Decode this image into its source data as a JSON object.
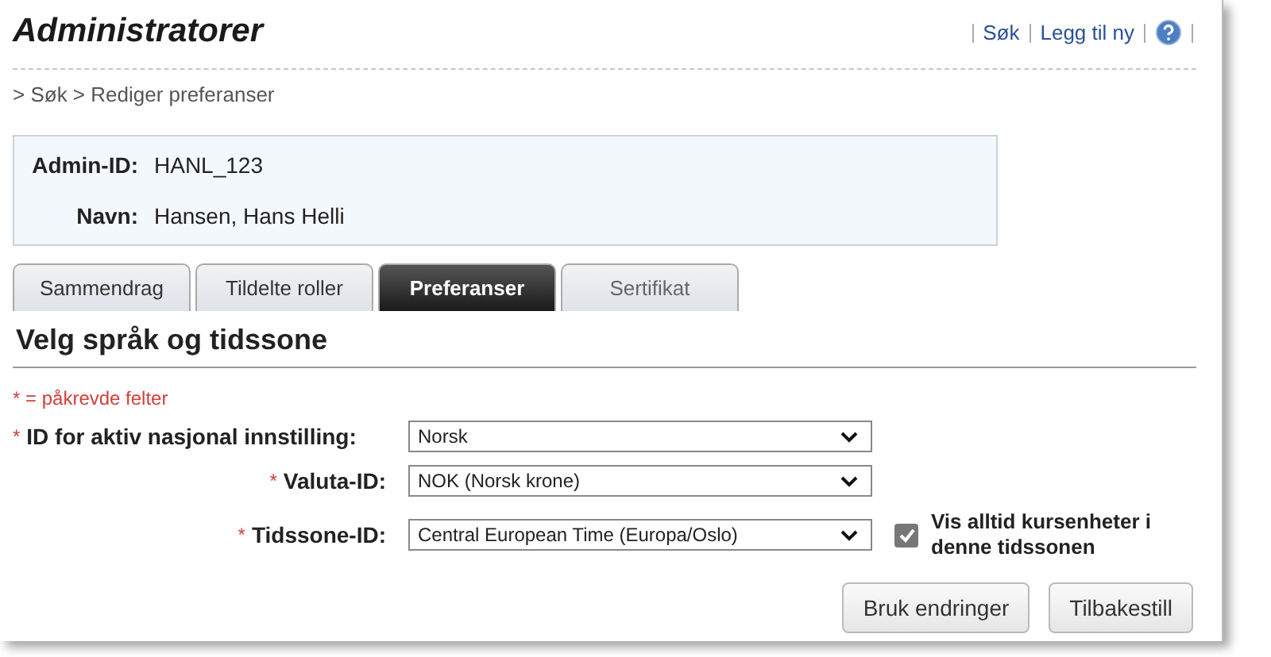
{
  "header": {
    "title": "Administratorer",
    "links": [
      {
        "kind": "link",
        "label": "Søk"
      },
      {
        "kind": "link",
        "label": "Legg til ny"
      },
      {
        "kind": "help"
      }
    ]
  },
  "breadcrumb": "> Søk > Rediger preferanser",
  "info": [
    {
      "label": "Admin-ID:",
      "value": "HANL_123"
    },
    {
      "label": "Navn:",
      "value": "Hansen, Hans Helli"
    }
  ],
  "tabs": [
    {
      "label": "Sammendrag",
      "selected": false
    },
    {
      "label": "Tildelte roller",
      "selected": false
    },
    {
      "label": "Preferanser",
      "selected": true
    },
    {
      "label": "Sertifikat",
      "selected": false,
      "disabled": true
    }
  ],
  "section_title": "Velg språk og tidssone",
  "required_note": "* = påkrevde felter",
  "fields": [
    {
      "marker": "*",
      "label": "ID for aktiv nasjonal innstilling:",
      "value": "Norsk"
    },
    {
      "marker": "*",
      "label": "Valuta-ID:",
      "value": "NOK (Norsk krone)"
    },
    {
      "marker": "*",
      "label": "Tidssone-ID:",
      "value": "Central European Time (Europa/Oslo)",
      "checkbox": {
        "label": "Vis alltid kursenheter i denne tidssonen",
        "checked": true
      }
    }
  ],
  "buttons": [
    "Bruk endringer",
    "Tilbakestill"
  ]
}
